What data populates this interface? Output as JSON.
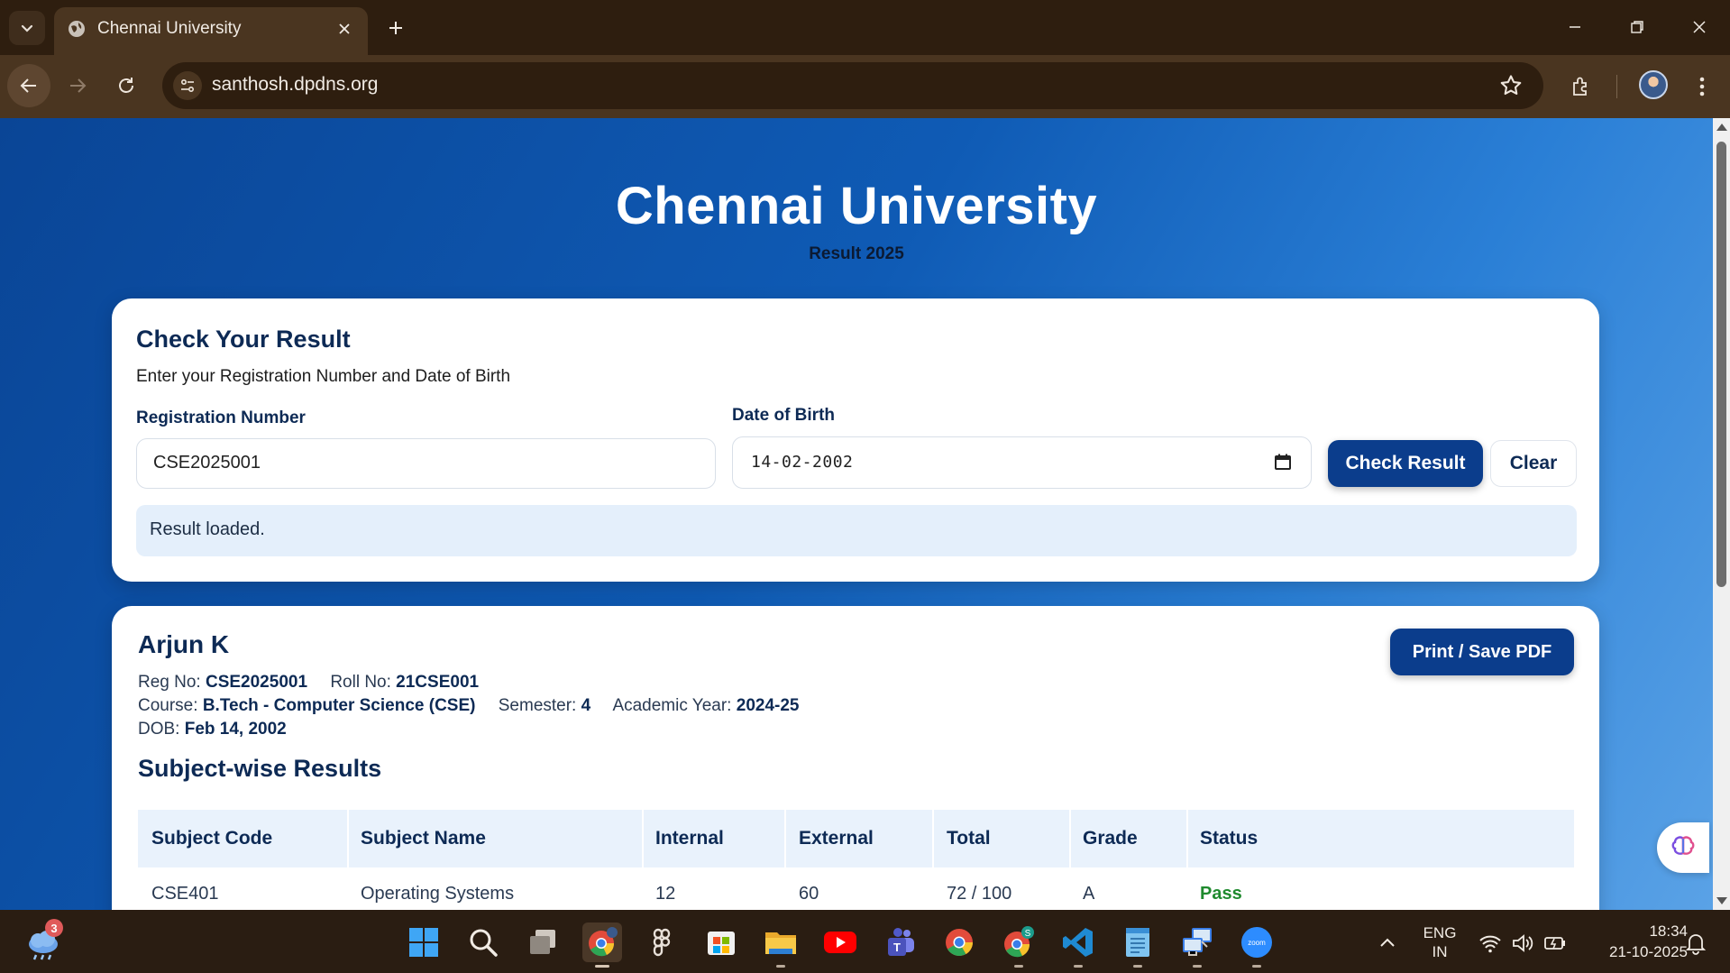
{
  "browser": {
    "tab_title": "Chennai University",
    "url": "santhosh.dpdns.org"
  },
  "page": {
    "title": "Chennai University",
    "subtitle": "Result 2025"
  },
  "search_card": {
    "title": "Check Your Result",
    "instructions": "Enter your Registration Number and Date of Birth",
    "reg_label": "Registration Number",
    "reg_value": "CSE2025001",
    "dob_label": "Date of Birth",
    "dob_value": "14-02-2002",
    "check_button": "Check Result",
    "clear_button": "Clear",
    "status_message": "Result loaded."
  },
  "result_card": {
    "student_name": "Arjun K",
    "reg_no_label": "Reg No:",
    "reg_no": "CSE2025001",
    "roll_no_label": "Roll No:",
    "roll_no": "21CSE001",
    "course_label": "Course:",
    "course": "B.Tech - Computer Science (CSE)",
    "semester_label": "Semester:",
    "semester": "4",
    "academic_year_label": "Academic Year:",
    "academic_year": "2024-25",
    "dob_label": "DOB:",
    "dob": "Feb 14, 2002",
    "print_button": "Print / Save PDF",
    "section_title": "Subject-wise Results",
    "table": {
      "headers": [
        "Subject Code",
        "Subject Name",
        "Internal",
        "External",
        "Total",
        "Grade",
        "Status"
      ],
      "rows": [
        [
          "CSE401",
          "Operating Systems",
          "12",
          "60",
          "72 / 100",
          "A",
          "Pass"
        ]
      ]
    }
  },
  "taskbar": {
    "weather_badge": "3",
    "lang_line1": "ENG",
    "lang_line2": "IN",
    "time": "18:34",
    "date": "21-10-2025",
    "icons": [
      "start-icon",
      "search-icon",
      "task-view-icon",
      "chrome-profile-icon",
      "figma-icon",
      "microsoft-store-icon",
      "file-explorer-icon",
      "youtube-icon",
      "teams-icon",
      "chrome-icon",
      "chrome-profile-s-icon",
      "vscode-icon",
      "notepad-icon",
      "remote-desktop-icon",
      "zoom-icon"
    ]
  },
  "colors": {
    "primary": "#0b3d8c",
    "heading": "#0d2a55",
    "pass": "#1f8a2e",
    "notice_bg": "#e4effb",
    "chrome_dark": "#2e1e0f",
    "chrome_mid": "#4a3520"
  }
}
